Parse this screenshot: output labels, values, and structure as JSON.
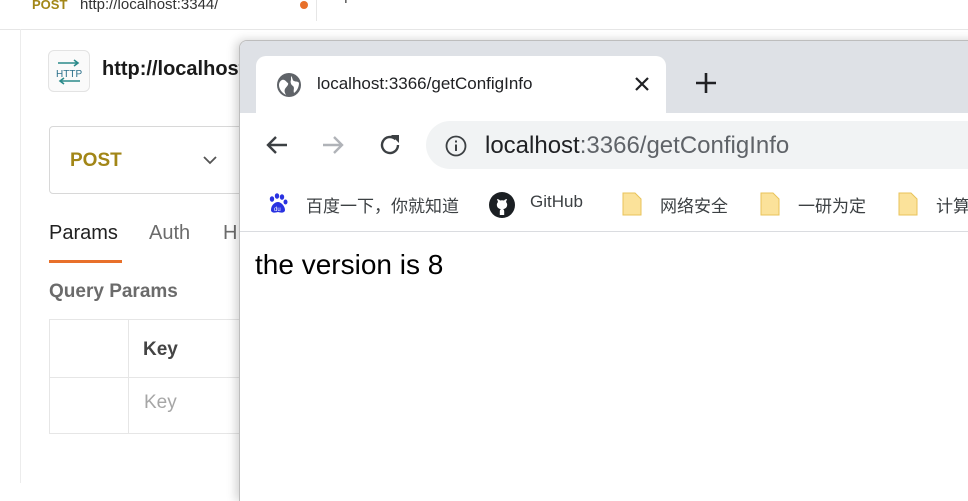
{
  "background_app": {
    "tab": {
      "method": "POST",
      "url": "http://localhost:3344/"
    },
    "request_title": "http://localhost",
    "icon_text": "HTTP",
    "method_select": {
      "value": "POST"
    },
    "request_tabs": [
      {
        "label": "Params",
        "active": true
      },
      {
        "label": "Auth",
        "active": false
      },
      {
        "label": "H",
        "active": false
      }
    ],
    "query_params_title": "Query Params",
    "table": {
      "header_key": "Key",
      "key_placeholder": "Key"
    },
    "colors": {
      "method": "#a28617",
      "accent": "#e8702a"
    }
  },
  "browser": {
    "tab": {
      "title": "localhost:3366/getConfigInfo",
      "icon": "globe-icon"
    },
    "address": {
      "host": "localhost",
      "path": ":3366/getConfigInfo"
    },
    "bookmarks": [
      {
        "label": "百度一下，你就知道",
        "icon": "baidu-icon"
      },
      {
        "label": "GitHub",
        "icon": "github-icon"
      },
      {
        "label": "网络安全",
        "icon": "folder-icon"
      },
      {
        "label": "一研为定",
        "icon": "folder-icon"
      },
      {
        "label": "计算",
        "icon": "folder-icon"
      }
    ],
    "page_text": "the version is 8"
  }
}
